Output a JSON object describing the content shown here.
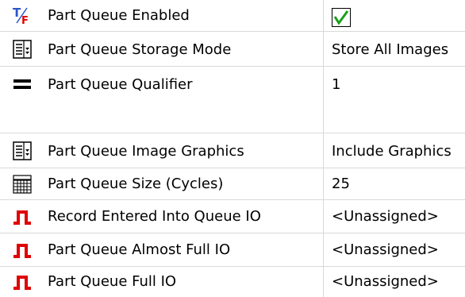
{
  "rows": [
    {
      "label": "Part Queue Enabled",
      "icon": "true-false-icon",
      "value": "",
      "value_type": "checkbox",
      "checked": true,
      "check_color": "#18a018"
    },
    {
      "label": "Part Queue Storage Mode",
      "icon": "list-dropdown-icon",
      "value": "Store All Images",
      "value_type": "text"
    },
    {
      "label": "Part Queue Qualifier",
      "icon": "equals-icon",
      "value": "1",
      "value_type": "text"
    },
    {
      "label": "Part Queue Image Graphics",
      "icon": "list-dropdown-icon",
      "value": "Include Graphics",
      "value_type": "text"
    },
    {
      "label": "Part Queue Size (Cycles)",
      "icon": "numeric-keypad-icon",
      "value": "25",
      "value_type": "text"
    },
    {
      "label": "Record Entered Into Queue IO",
      "icon": "pulse-signal-icon",
      "value": "<Unassigned>",
      "value_type": "text"
    },
    {
      "label": "Part Queue Almost Full IO",
      "icon": "pulse-signal-icon",
      "value": "<Unassigned>",
      "value_type": "text"
    },
    {
      "label": "Part Queue Full IO",
      "icon": "pulse-signal-icon",
      "value": "<Unassigned>",
      "value_type": "text"
    }
  ],
  "colors": {
    "grid_line": "#d9d9d9",
    "pulse_red": "#e00000",
    "true_blue": "#2b56c8",
    "false_red": "#e00000"
  }
}
